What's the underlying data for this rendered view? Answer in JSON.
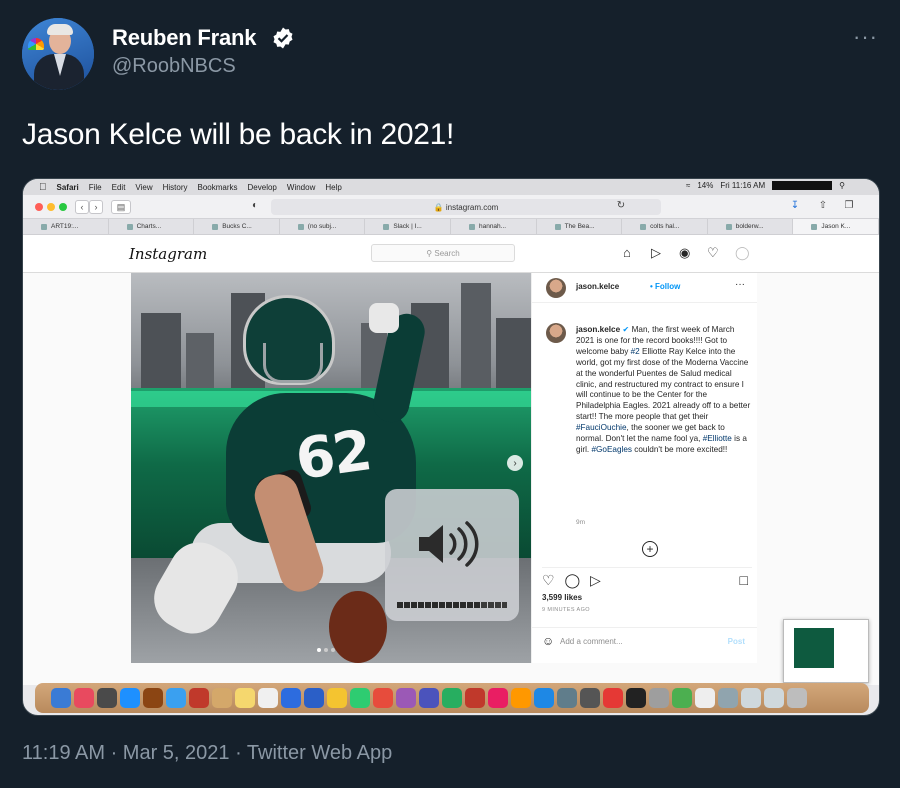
{
  "tweet": {
    "author_name": "Reuben Frank",
    "handle": "@RoobNBCS",
    "text": "Jason Kelce will be back in 2021!",
    "more_label": "···",
    "timestamp": "11:19 AM · Mar 5, 2021 · Twitter Web App"
  },
  "menubar": {
    "apple": "",
    "items": [
      "Safari",
      "File",
      "Edit",
      "View",
      "History",
      "Bookmarks",
      "Develop",
      "Window",
      "Help"
    ],
    "battery": "14%",
    "clock": "Fri 11:16 AM"
  },
  "safari": {
    "url": "🔒 instagram.com",
    "tabs": [
      "ART19:...",
      "Charts...",
      "Bucks C...",
      "(no subj...",
      "Slack | I...",
      "hannah...",
      "The Bea...",
      "colts hal...",
      "bolderw...",
      "Jason K..."
    ]
  },
  "instagram": {
    "logo": "Instagram",
    "search_placeholder": "Search",
    "post": {
      "username": "jason.kelce",
      "follow": "Follow",
      "jersey_number": "62",
      "caption_parts": [
        {
          "t": "Man, the first week of March 2021 is one for the record books!!!! Got to welcome baby "
        },
        {
          "t": "#2",
          "tag": true
        },
        {
          "t": " Elliotte Ray Kelce into the world, got my first dose of the Moderna Vaccine at the wonderful Puentes de Salud medical clinic, and restructured my contract to ensure I will continue to be the Center for the Philadelphia Eagles. 2021 already off to a better start!! The more people that get their "
        },
        {
          "t": "#FauciOuchie",
          "tag": true
        },
        {
          "t": ", the sooner we get back to normal. Don't let the name fool ya, "
        },
        {
          "t": "#Elliotte",
          "tag": true
        },
        {
          "t": " is a girl. "
        },
        {
          "t": "#GoEagles",
          "tag": true
        },
        {
          "t": " couldn't be more excited!!"
        }
      ],
      "caption_time": "9m",
      "likes": "3,599 likes",
      "ago": "9 MINUTES AGO",
      "comment_placeholder": "Add a comment...",
      "post_button": "Post"
    }
  },
  "volume_hud": {
    "level": 0.75
  },
  "dock_colors": [
    "#3a7bd5",
    "#e84a5f",
    "#4a4a4a",
    "#1e90ff",
    "#8b4513",
    "#3aa0f0",
    "#c0392b",
    "#d4a86a",
    "#f5d76e",
    "#f0f0f0",
    "#2d6cdf",
    "#2b5fc7",
    "#f4c430",
    "#2ecc71",
    "#e74c3c",
    "#9b59b6",
    "#4b53bc",
    "#27ae60",
    "#c0392b",
    "#e91e63",
    "#ff9800",
    "#1e88e5",
    "#607d8b",
    "#555",
    "#e53935",
    "#222",
    "#9e9e9e",
    "#4caf50",
    "#eeeeee",
    "#90a4ae",
    "#cfd8dc",
    "#cfd8dc",
    "#bdbdbd"
  ]
}
